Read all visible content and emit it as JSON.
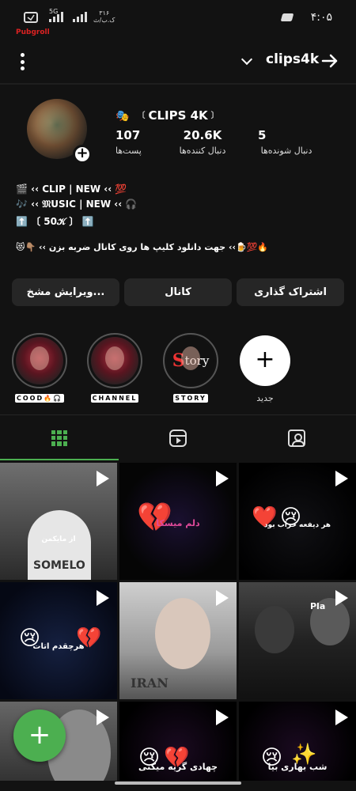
{
  "status_bar": {
    "network": "5G",
    "speed": "۳۱۶",
    "speed_unit": "ک.ب/ث",
    "time": "۴:۰۵"
  },
  "watermark": "Pubgroll",
  "header": {
    "username": "clips4k"
  },
  "profile": {
    "display_name": "CLIPS 4K",
    "name_emoji": "🎭",
    "bracket_left": "〔",
    "bracket_right": "〕",
    "stats": [
      {
        "value": "107",
        "label": "پست‌ها"
      },
      {
        "value": "20.6K",
        "label": "دنبال کننده‌ها"
      },
      {
        "value": "5",
        "label": "دنبال شونده‌ها"
      }
    ],
    "bio_lines": [
      "🎬 ‹‹ CLIP | NEW ‹‹ 💯",
      "🎶 ‹‹ 𝔐USIC | NEW ‹‹ 🎧",
      "⬆️ 〔 50𝒦 〕 ⬆️",
      "😻👇🏽 ‹‹ جهت دانلود کلیپ ها روی کانال ضربه بزن ‹‹🍺💯🔥"
    ]
  },
  "buttons": {
    "edit": "ویرایش مشخ...",
    "channel": "کانال",
    "share": "اشتراک گذاری"
  },
  "highlights": [
    {
      "label": "COOD🔥🎧"
    },
    {
      "label": "CHANNEL"
    },
    {
      "label": "STORY",
      "story_text": "tory",
      "story_letter": "S"
    },
    {
      "label": "جدید",
      "plus": "+"
    }
  ],
  "posts": [
    {
      "caption": "از مایکمن",
      "overlay": "SOMELO"
    },
    {
      "caption": "دلم میسکا"
    },
    {
      "caption": "هر دیفعه خراب بود"
    },
    {
      "caption": "هرچقدم اتات"
    },
    {
      "caption": "IRAN"
    },
    {
      "caption": "Pla"
    },
    {
      "caption": ""
    },
    {
      "caption": "چهادی گریه میکنی"
    },
    {
      "caption": "شب بهاری بیا"
    }
  ],
  "fab": "+",
  "colors": {
    "accent": "#4caf50",
    "background": "#121212",
    "button_bg": "#262626"
  },
  "icons": {
    "menu": "kebab-menu-icon",
    "dropdown": "chevron-down-icon",
    "back": "arrow-right-icon",
    "grid": "grid-icon",
    "reels": "reels-icon",
    "tagged": "tagged-icon",
    "play": "play-icon"
  }
}
